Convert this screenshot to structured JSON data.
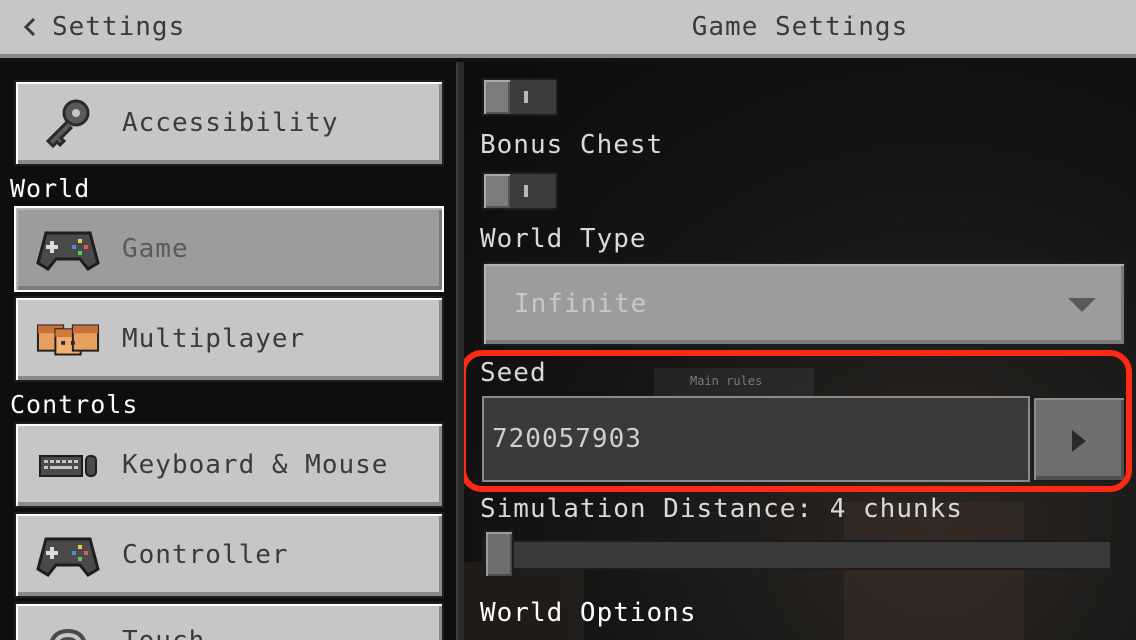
{
  "header": {
    "back_label": "Settings",
    "title": "Game Settings"
  },
  "sidebar": {
    "items_top": [
      {
        "label": "Accessibility",
        "icon": "key-icon"
      }
    ],
    "world_section": "World",
    "world_items": [
      {
        "label": "Game",
        "icon": "controller-icon",
        "selected": true
      },
      {
        "label": "Multiplayer",
        "icon": "players-icon"
      }
    ],
    "controls_section": "Controls",
    "controls_items": [
      {
        "label": "Keyboard & Mouse",
        "icon": "keyboard-mouse-icon"
      },
      {
        "label": "Controller",
        "icon": "controller-icon"
      },
      {
        "label": "Touch",
        "icon": "touch-icon"
      }
    ]
  },
  "main": {
    "toggle1": {
      "state": "off"
    },
    "bonus_chest": {
      "label": "Bonus Chest",
      "state": "off"
    },
    "world_type": {
      "label": "World Type",
      "value": "Infinite"
    },
    "seed": {
      "label": "Seed",
      "value": "720057903",
      "ghost_text": "Main rules"
    },
    "simulation": {
      "label": "Simulation Distance: 4 chunks",
      "value_chunks": 4
    },
    "world_options": {
      "label": "World Options"
    }
  },
  "colors": {
    "highlight": "#ff2a14",
    "button": "#c6c6c6",
    "button_selected": "#9c9c9c"
  }
}
